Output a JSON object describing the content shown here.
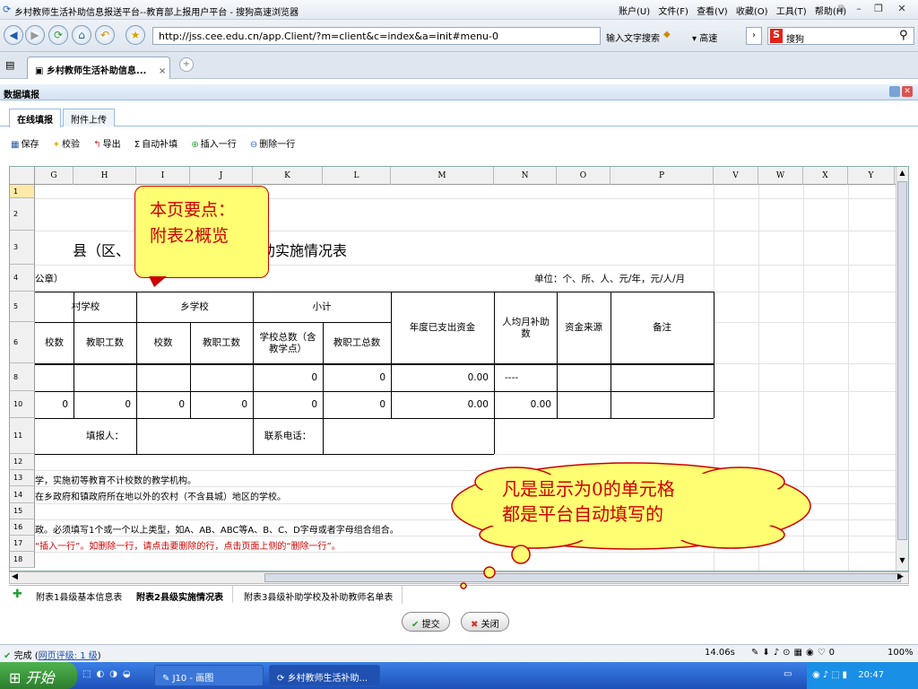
{
  "browser": {
    "title": "乡村教师生活补助信息报送平台--教育部上报用户平台 - 搜狗高速浏览器",
    "menus": [
      "账户(U)",
      "文件(F)",
      "查看(V)",
      "收藏(O)",
      "工具(T)",
      "帮助(H)"
    ],
    "url": "http://jss.cee.edu.cn/app.Client/?m=client&c=index&a=init#menu-0",
    "input_hint": "输入文字搜索",
    "speed_label": "高速",
    "search_engine": "搜狗",
    "tab_label": "乡村教师生活补助信息...",
    "tab_close": "×"
  },
  "panel": {
    "title": "数据填报",
    "tabs": [
      "在线填报",
      "附件上传"
    ]
  },
  "toolbar": {
    "save": "保存",
    "check": "校验",
    "export": "导出",
    "autofill": "自动补填",
    "insert_row": "插入一行",
    "delete_row": "删除一行"
  },
  "sheet": {
    "columns": [
      "G",
      "H",
      "I",
      "J",
      "K",
      "L",
      "M",
      "N",
      "O",
      "P",
      "V",
      "W",
      "X",
      "Y"
    ],
    "rows": [
      "1",
      "2",
      "3",
      "4",
      "5",
      "6",
      "8",
      "10",
      "11",
      "12",
      "13",
      "14",
      "15",
      "16",
      "17",
      "18"
    ],
    "title": "县（区、",
    "title_rest": "助实施情况表",
    "stamp": "公章）",
    "unit": "单位：个、所、人、元/年，元/人/月",
    "hdr_village": "村学校",
    "hdr_township": "乡学校",
    "hdr_subtotal": "小计",
    "hdr_annual": "年度已支出资金",
    "hdr_permonth": "人均月补助数",
    "hdr_source": "资金来源",
    "hdr_remark": "备注",
    "sub_count": "校数",
    "sub_staff": "教职工数",
    "sub_count2": "校数",
    "sub_staff2": "教职工数",
    "sub_total_schools": "学校总数（含教学点）",
    "sub_total_staff": "教职工总数",
    "r8_k": "0",
    "r8_l": "0",
    "r8_m": "0.00",
    "r8_n": "----",
    "r10_g": "0",
    "r10_h": "0",
    "r10_i": "0",
    "r10_j": "0",
    "r10_k": "0",
    "r10_l": "0",
    "r10_m": "0.00",
    "r10_n": "0.00",
    "filler": "填报人：",
    "phone": "联系电话：",
    "note13": "学，实施初等教育不计校数的教学机构。",
    "note14": "在乡政府和镇政府所在地以外的农村（不含县城）地区的学校。",
    "note16": "政。必须填写1个或一个以上类型，如A、AB、ABC等A、B、C、D字母或者字母组合组合。",
    "note17": "“插入一行”。如删除一行，请点击要删除的行，点击页面上侧的“删除一行”。"
  },
  "sheet_tabs": [
    "附表1县级基本信息表",
    "附表2县级实施情况表",
    "附表3县级补助学校及补助教师名单表"
  ],
  "buttons": {
    "submit": "提交",
    "close": "关闭"
  },
  "status": {
    "done": "完成",
    "rating": "网页评级: 1 级",
    "load_time": "14.06s",
    "zoom": "100%"
  },
  "taskbar": {
    "start": "开始",
    "task1": "J10 - 画图",
    "task2": "乡村教师生活补助...",
    "clock": "20:47"
  },
  "callouts": {
    "box1_line1": "本页要点：",
    "box1_line2": "附表2概览",
    "cloud_line1": "凡是显示为0的单元格",
    "cloud_line2": "都是平台自动填写的"
  }
}
